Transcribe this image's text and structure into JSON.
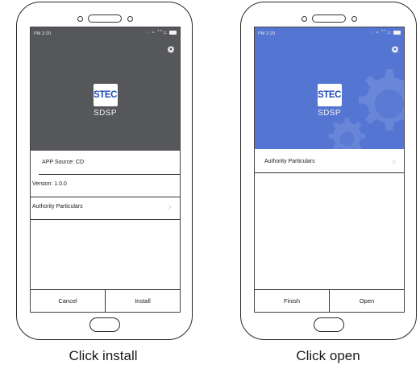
{
  "left_phone": {
    "status_time": "PM 2:20",
    "status_icons": "◌ ≈ ꜛꜛ⊂",
    "logo": "STEC",
    "app_name": "SDSP",
    "rows": [
      {
        "label": "APP Source: CD"
      },
      {
        "label": "Version: 1.0.0"
      },
      {
        "label": "Authority Particulars",
        "chevron": ">"
      }
    ],
    "buttons": {
      "left": "Cancel",
      "right": "Install"
    },
    "caption": "Click install",
    "header_color": "#56575a"
  },
  "right_phone": {
    "status_time": "PM 2:20",
    "status_icons": "◌ ≈ ꜛꜛ⊂",
    "logo": "STEC",
    "app_name": "SDSP",
    "rows": [
      {
        "label": "Authority Particulars",
        "chevron": ">"
      }
    ],
    "buttons": {
      "left": "Finish",
      "right": "Open"
    },
    "caption": "Click open",
    "header_color": "#5575d2"
  },
  "icons": {
    "settings": "gear-icon",
    "logo_mark": "stec-logo"
  },
  "colors": {
    "logo_text": "#1f49b6",
    "outline": "#2a2a2a"
  }
}
